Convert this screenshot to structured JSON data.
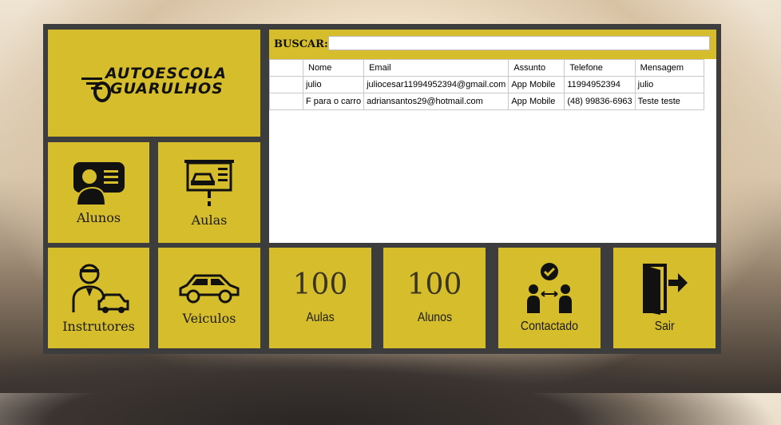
{
  "logo": {
    "line1": "AUTOESCOLA",
    "line2": "GUARULHOS"
  },
  "tiles": {
    "alunos": "Alunos",
    "aulas": "Aulas",
    "instrutores": "Instrutores",
    "veiculos": "Veiculos",
    "contactado": "Contactado",
    "sair": "Sair"
  },
  "counters": [
    {
      "value": "100",
      "label": "Aulas"
    },
    {
      "value": "100",
      "label": "Alunos"
    }
  ],
  "search": {
    "label": "BUSCAR:",
    "value": ""
  },
  "table": {
    "headers": [
      "",
      "Nome",
      "Email",
      "Assunto",
      "Telefone",
      "Mensagem"
    ],
    "rows": [
      [
        "",
        "julio",
        "juliocesar11994952394@gmail.com",
        "App Mobile",
        "11994952394",
        "julio"
      ],
      [
        "",
        "F para o carro",
        "adriansantos29@hotmail.com",
        "App Mobile",
        "(48) 99836-6963",
        "Teste teste"
      ]
    ]
  },
  "colors": {
    "tile": "#d6bd2c",
    "frame": "#3d3d3d"
  },
  "icons": [
    "student-id-icon",
    "classroom-board-icon",
    "instructor-icon",
    "car-icon",
    "contact-people-icon",
    "exit-door-icon"
  ]
}
